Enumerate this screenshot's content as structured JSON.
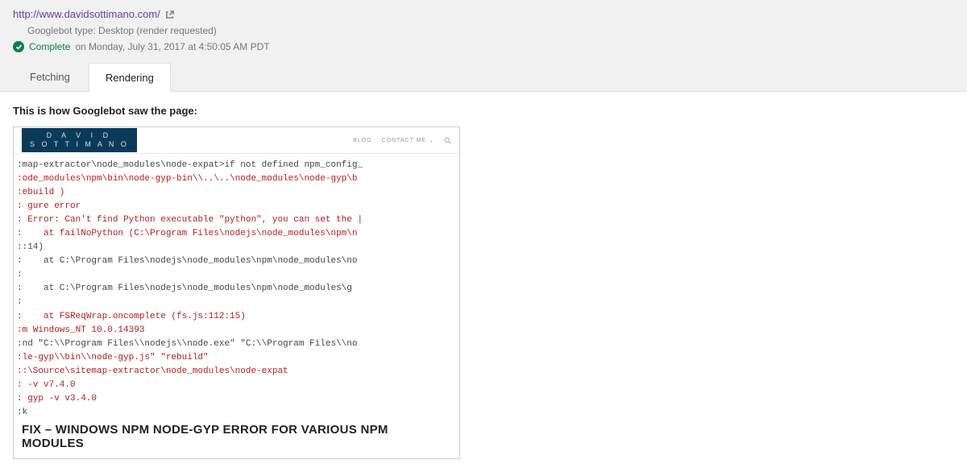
{
  "header": {
    "url": "http://www.davidsottimano.com/",
    "googlebot_line": "Googlebot type: Desktop (render requested)",
    "status_word": "Complete",
    "status_rest": "on Monday, July 31, 2017 at 4:50:05 AM PDT"
  },
  "tabs": {
    "fetching": "Fetching",
    "rendering": "Rendering"
  },
  "main": {
    "heading": "This is how Googlebot saw the page:"
  },
  "preview": {
    "logo_top": "D A V I D",
    "logo_bottom": "S O T T I M A N O",
    "nav_blog": "BLOG",
    "nav_contact": "CONTACT ME",
    "terminal": ":map-extractor\\node_modules\\node-expat>if not defined npm_config_\n:ode_modules\\npm\\bin\\node-gyp-bin\\\\..\\..\\node_modules\\node-gyp\\b\n:ebuild )\n: gure error\n: Error: Can't find Python executable \"python\", you can set the |\n:    at failNoPython (C:\\Program Files\\nodejs\\node_modules\\npm\\n\n::14)\n:    at C:\\Program Files\\nodejs\\node_modules\\npm\\node_modules\\no\n:\n:    at C:\\Program Files\\nodejs\\node_modules\\npm\\node_modules\\g\n:\n:    at FSReqWrap.oncomplete (fs.js:112:15)\n:m Windows_NT 10.0.14393\n:nd \"C:\\\\Program Files\\\\nodejs\\\\node.exe\" \"C:\\\\Program Files\\\\no\n:le-gyp\\\\bin\\\\node-gyp.js\" \"rebuild\"\n::\\Source\\sitemap-extractor\\node_modules\\node-expat\n: -v v7.4.0\n: gyp -v v3.4.0\n:k",
    "article_title": "FIX – WINDOWS NPM NODE-GYP ERROR FOR VARIOUS NPM MODULES"
  }
}
